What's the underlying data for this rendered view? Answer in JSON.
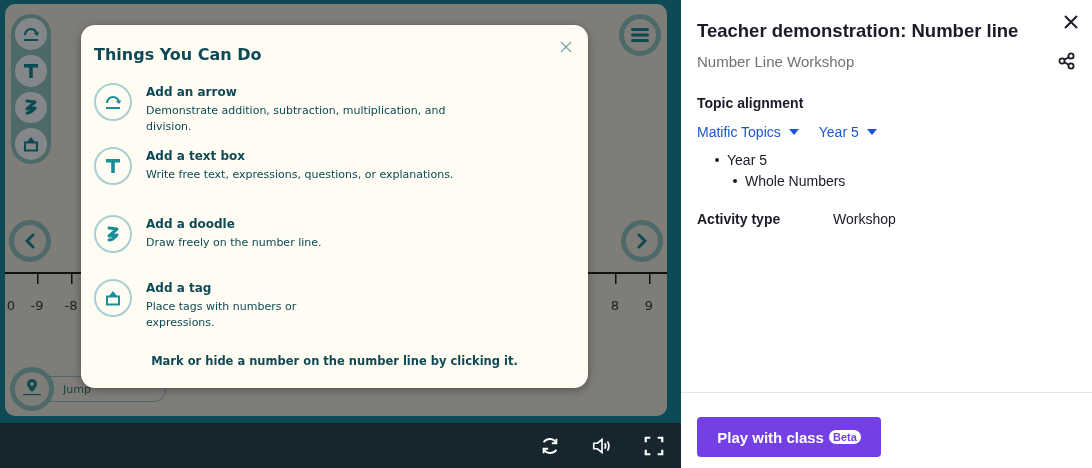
{
  "stage": {
    "tools": [
      {
        "kind": "arrow"
      },
      {
        "kind": "text"
      },
      {
        "kind": "doodle"
      },
      {
        "kind": "tag"
      }
    ],
    "number_line": {
      "left_labels": [
        "0",
        "-9",
        "-8"
      ],
      "right_labels": [
        "8",
        "9"
      ]
    },
    "jump_field": {
      "placeholder": "Jump"
    }
  },
  "dialog": {
    "title": "Things You Can Do",
    "items": [
      {
        "kind": "arrow",
        "title": "Add an arrow",
        "description": "Demonstrate addition, subtraction, multiplication, and division."
      },
      {
        "kind": "text",
        "title": "Add a text box",
        "description": "Write free text, expressions, questions, or explanations."
      },
      {
        "kind": "doodle",
        "title": "Add a doodle",
        "description": "Draw freely on the number line."
      },
      {
        "kind": "tag",
        "title": "Add a tag",
        "description": "Place tags with numbers or expressions."
      }
    ],
    "footer": "Mark or hide a number on the number line by clicking it."
  },
  "panel": {
    "title": "Teacher demonstration: Number line",
    "subtitle": "Number Line Workshop",
    "topic_heading": "Topic alignment",
    "dropdowns": [
      "Matific Topics",
      "Year 5"
    ],
    "topics": [
      {
        "label": "Year 5",
        "children": [
          {
            "label": "Whole Numbers"
          }
        ]
      }
    ],
    "activity_label": "Activity type",
    "activity_value": "Workshop",
    "play_button": {
      "label": "Play with class",
      "badge": "Beta"
    }
  }
}
